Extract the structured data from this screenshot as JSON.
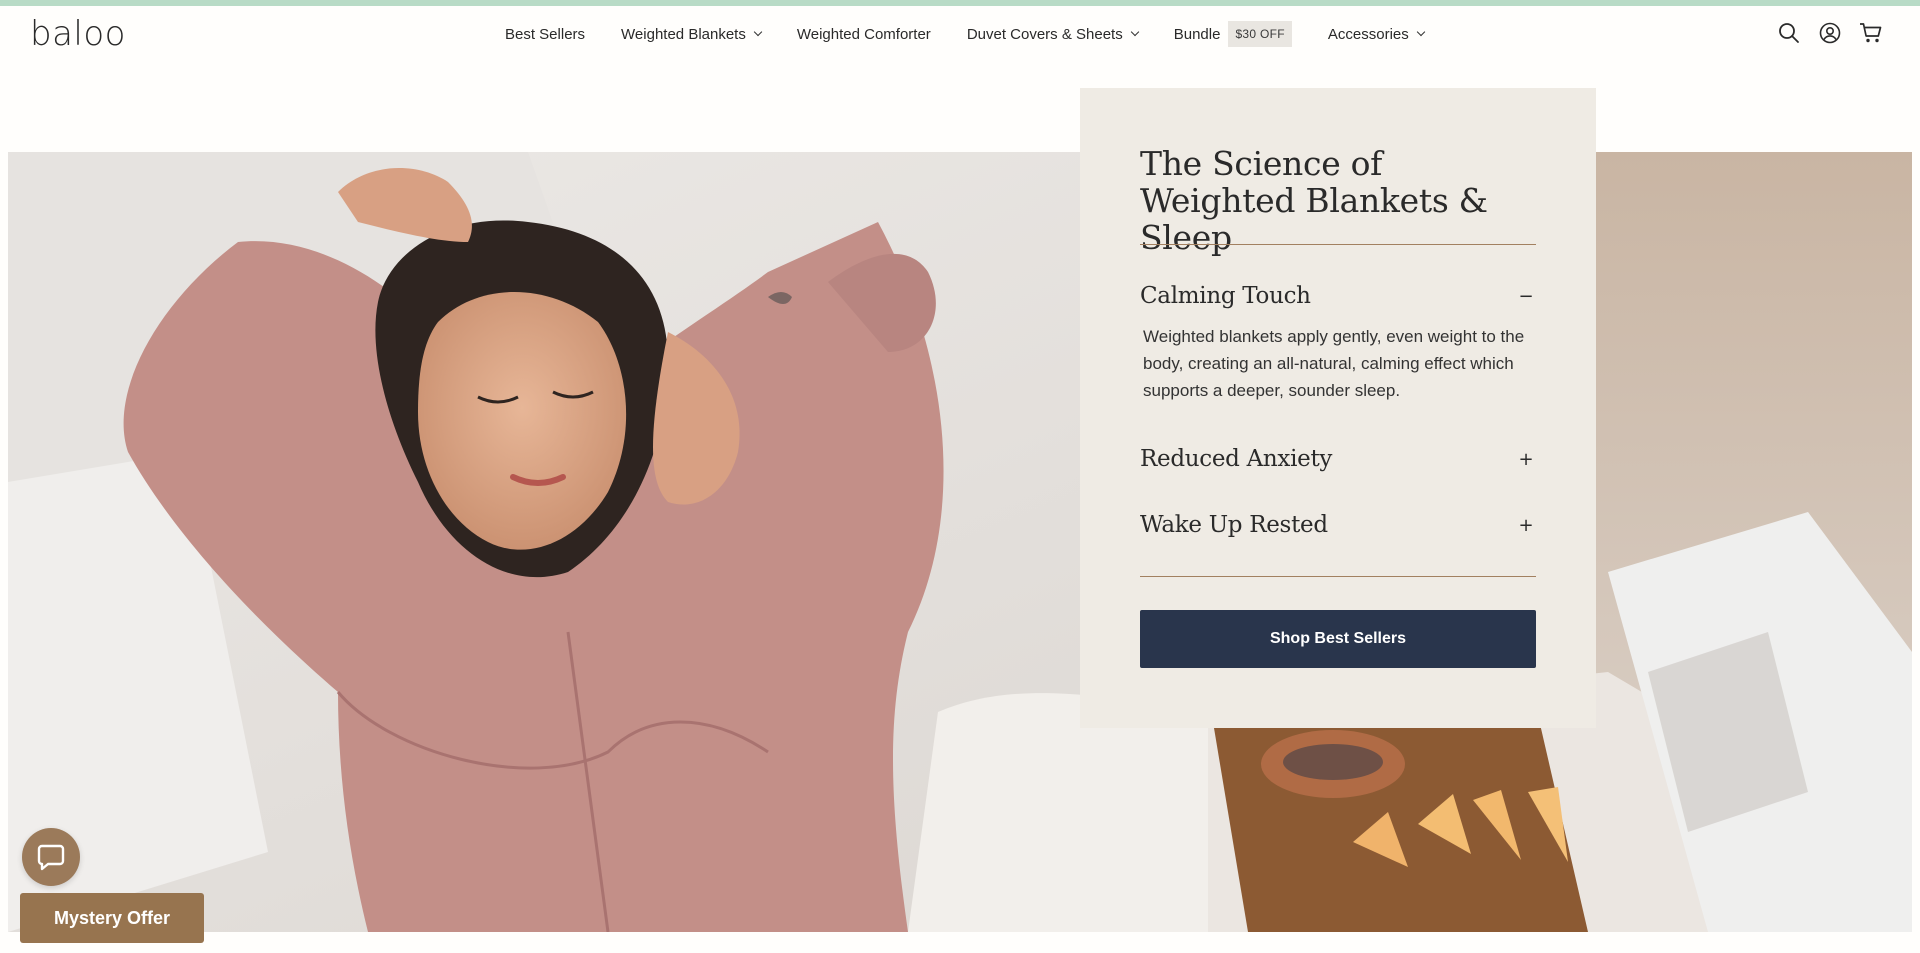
{
  "brand": {
    "logo_text": "baloo"
  },
  "nav": {
    "items": [
      {
        "label": "Best Sellers",
        "dropdown": false
      },
      {
        "label": "Weighted Blankets",
        "dropdown": true
      },
      {
        "label": "Weighted Comforter",
        "dropdown": false
      },
      {
        "label": "Duvet Covers & Sheets",
        "dropdown": true
      },
      {
        "label": "Bundle",
        "badge": "$30 OFF",
        "dropdown": false
      },
      {
        "label": "Accessories",
        "dropdown": true
      }
    ]
  },
  "header_icons": [
    "search-icon",
    "account-icon",
    "cart-icon"
  ],
  "panel": {
    "title": "The Science of Weighted Blankets & Sleep",
    "accordion": [
      {
        "label": "Calming Touch",
        "sign": "−",
        "expanded": true,
        "body": "Weighted blankets apply gently, even weight to the body, creating an all-natural, calming effect which supports a deeper, sounder sleep."
      },
      {
        "label": "Reduced Anxiety",
        "sign": "+",
        "expanded": false
      },
      {
        "label": "Wake Up Rested",
        "sign": "+",
        "expanded": false
      }
    ],
    "cta_label": "Shop Best Sellers"
  },
  "floating": {
    "mystery_offer_label": "Mystery Offer",
    "chat_icon": "chat-icon"
  },
  "colors": {
    "accent_stripe": "#b8dbc6",
    "panel_bg": "#efebe4",
    "cta_bg": "#29354c",
    "mystery_bg": "#97744f",
    "rule": "#a28060"
  }
}
